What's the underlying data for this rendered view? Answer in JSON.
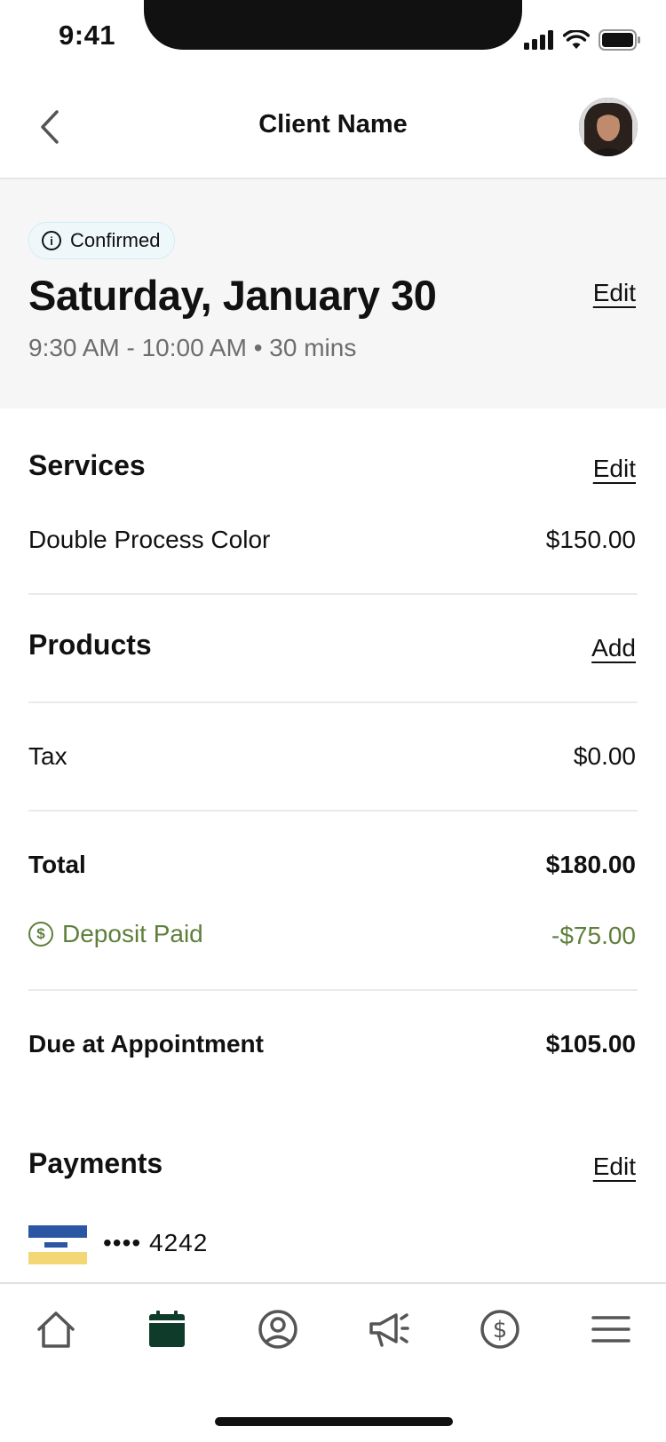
{
  "status_bar": {
    "time": "9:41"
  },
  "nav": {
    "title": "Client Name"
  },
  "appointment": {
    "status": "Confirmed",
    "date": "Saturday, January 30",
    "time_range": "9:30 AM - 10:00 AM • 30 mins",
    "edit_label": "Edit"
  },
  "services": {
    "title": "Services",
    "action_label": "Edit",
    "items": [
      {
        "name": "Double Process Color",
        "price": "$150.00"
      }
    ]
  },
  "products": {
    "title": "Products",
    "action_label": "Add"
  },
  "tax": {
    "label": "Tax",
    "value": "$0.00"
  },
  "total": {
    "label": "Total",
    "value": "$180.00"
  },
  "deposit": {
    "label": "Deposit Paid",
    "value": "-$75.00"
  },
  "due": {
    "label": "Due at Appointment",
    "value": "$105.00"
  },
  "payments": {
    "title": "Payments",
    "action_label": "Edit",
    "card_masked": "•••• 4242"
  },
  "tabbar": {
    "active": "calendar",
    "items": [
      "home-icon",
      "calendar-icon",
      "profile-icon",
      "megaphone-icon",
      "dollar-icon",
      "menu-icon"
    ]
  },
  "colors": {
    "accent_green": "#5f7f3c",
    "active_tab": "#0f3b2a",
    "card_blue": "#2b56a3",
    "card_yellow": "#f3d774"
  }
}
